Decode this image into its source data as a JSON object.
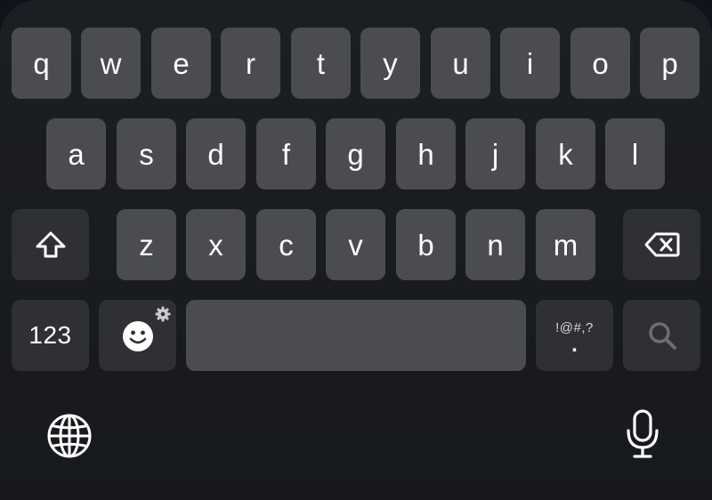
{
  "keyboard": {
    "row1": [
      "q",
      "w",
      "e",
      "r",
      "t",
      "y",
      "u",
      "i",
      "o",
      "p"
    ],
    "row2": [
      "a",
      "s",
      "d",
      "f",
      "g",
      "h",
      "j",
      "k",
      "l"
    ],
    "row3": [
      "z",
      "x",
      "c",
      "v",
      "b",
      "n",
      "m"
    ],
    "shift_icon": "shift-arrow-icon",
    "backspace_icon": "backspace-icon",
    "numbers_label": "123",
    "emoji_icon": "smiley-icon",
    "settings_icon": "gear-icon",
    "space_label": "",
    "symbols_hint": "!@#,?",
    "period_label": ".",
    "search_icon": "search-icon",
    "globe_icon": "globe-icon",
    "mic_icon": "microphone-icon"
  },
  "colors": {
    "background": "#1b1e22",
    "letter_key": "#4a4c50",
    "function_key": "#2e3034",
    "text": "#ffffff",
    "search_icon": "#6c6e72"
  }
}
